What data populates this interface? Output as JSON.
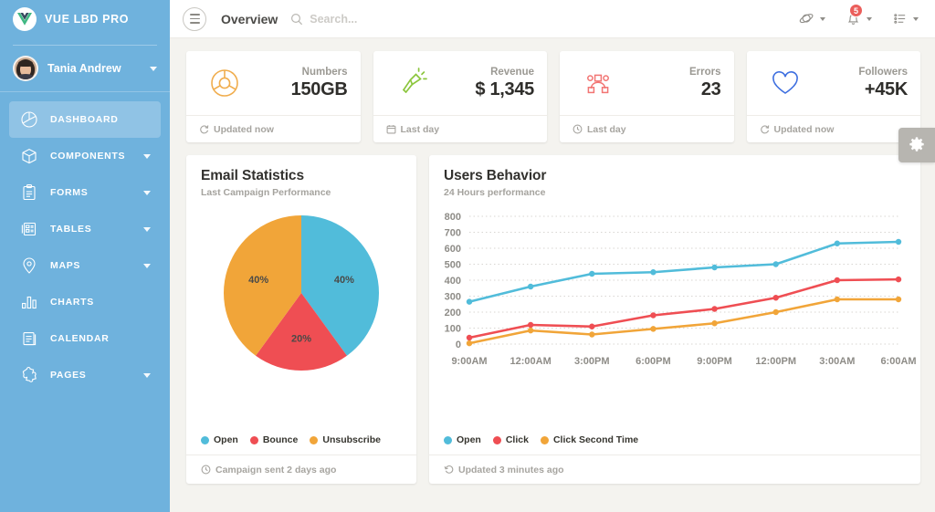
{
  "sidebar": {
    "brand": {
      "title": "VUE LBD PRO",
      "logo_icon": "vue-logo-icon"
    },
    "user": {
      "name": "Tania Andrew",
      "avatar_icon": "user-avatar",
      "caret_icon": "chevron-down-icon"
    },
    "items": [
      {
        "label": "DASHBOARD",
        "icon": "pie-chart-icon",
        "active": true,
        "expandable": false
      },
      {
        "label": "COMPONENTS",
        "icon": "cube-icon",
        "active": false,
        "expandable": true
      },
      {
        "label": "FORMS",
        "icon": "clipboard-icon",
        "active": false,
        "expandable": true
      },
      {
        "label": "TABLES",
        "icon": "table-icon",
        "active": false,
        "expandable": true
      },
      {
        "label": "MAPS",
        "icon": "map-pin-icon",
        "active": false,
        "expandable": true
      },
      {
        "label": "CHARTS",
        "icon": "bar-chart-icon",
        "active": false,
        "expandable": false
      },
      {
        "label": "CALENDAR",
        "icon": "calendar-icon",
        "active": false,
        "expandable": false
      },
      {
        "label": "PAGES",
        "icon": "puzzle-icon",
        "active": false,
        "expandable": true
      }
    ]
  },
  "topbar": {
    "menu_icon": "hamburger-icon",
    "title": "Overview",
    "search": {
      "placeholder": "Search...",
      "value": "",
      "icon": "search-icon"
    },
    "actions": [
      {
        "name": "dashboard-stats",
        "icon": "stats-icon",
        "badge": ""
      },
      {
        "name": "notifications",
        "icon": "bell-icon",
        "badge": "5"
      },
      {
        "name": "task-list",
        "icon": "list-icon",
        "badge": ""
      }
    ]
  },
  "stats": [
    {
      "label": "Numbers",
      "value": "150GB",
      "icon": "donut-chart-icon",
      "color": "#f0ad4e",
      "footer": "Updated now",
      "footer_icon": "refresh-icon"
    },
    {
      "label": "Revenue",
      "value": "$ 1,345",
      "icon": "torch-icon",
      "color": "#8cc63e",
      "footer": "Last day",
      "footer_icon": "calendar-icon"
    },
    {
      "label": "Errors",
      "value": "23",
      "icon": "vector-node-icon",
      "color": "#f27573",
      "footer": "Last day",
      "footer_icon": "clock-icon"
    },
    {
      "label": "Followers",
      "value": "+45K",
      "icon": "heart-icon",
      "color": "#3e6fe0",
      "footer": "Updated now",
      "footer_icon": "refresh-icon"
    }
  ],
  "email_card": {
    "title": "Email Statistics",
    "subtitle": "Last Campaign Performance",
    "legend": [
      {
        "label": "Open",
        "color": "#51bcda"
      },
      {
        "label": "Bounce",
        "color": "#ef4e53"
      },
      {
        "label": "Unsubscribe",
        "color": "#f1a539"
      }
    ],
    "footer": "Campaign sent 2 days ago",
    "footer_icon": "clock-icon"
  },
  "users_card": {
    "title": "Users Behavior",
    "subtitle": "24 Hours performance",
    "legend": [
      {
        "label": "Open",
        "color": "#51bcda"
      },
      {
        "label": "Click",
        "color": "#ef4e53"
      },
      {
        "label": "Click Second Time",
        "color": "#f1a539"
      }
    ],
    "footer": "Updated 3 minutes ago",
    "footer_icon": "history-icon"
  },
  "fab": {
    "name": "settings-fab",
    "icon": "gear-icon"
  },
  "chart_data": [
    {
      "type": "pie",
      "title": "Email Statistics",
      "subtitle": "Last Campaign Performance",
      "labels": [
        "Open",
        "Bounce",
        "Unsubscribe"
      ],
      "values": [
        40,
        20,
        40
      ],
      "value_labels": [
        "40%",
        "20%",
        "40%"
      ],
      "colors": [
        "#51bcda",
        "#ef4e53",
        "#f1a539"
      ],
      "legend_position": "bottom"
    },
    {
      "type": "line",
      "title": "Users Behavior",
      "subtitle": "24 Hours performance",
      "x": [
        "9:00AM",
        "12:00AM",
        "3:00PM",
        "6:00PM",
        "9:00PM",
        "12:00PM",
        "3:00AM",
        "6:00AM"
      ],
      "xlabel": "",
      "ylabel": "",
      "ylim": [
        0,
        800
      ],
      "yticks": [
        0,
        100,
        200,
        300,
        400,
        500,
        600,
        700,
        800
      ],
      "grid": true,
      "legend_position": "bottom",
      "series": [
        {
          "name": "Open",
          "color": "#51bcda",
          "values": [
            265,
            360,
            440,
            450,
            480,
            500,
            630,
            640
          ]
        },
        {
          "name": "Click",
          "color": "#ef4e53",
          "values": [
            40,
            120,
            110,
            180,
            220,
            290,
            400,
            405
          ]
        },
        {
          "name": "Click Second Time",
          "color": "#f1a539",
          "values": [
            5,
            85,
            60,
            95,
            130,
            200,
            280,
            280
          ]
        }
      ]
    }
  ]
}
